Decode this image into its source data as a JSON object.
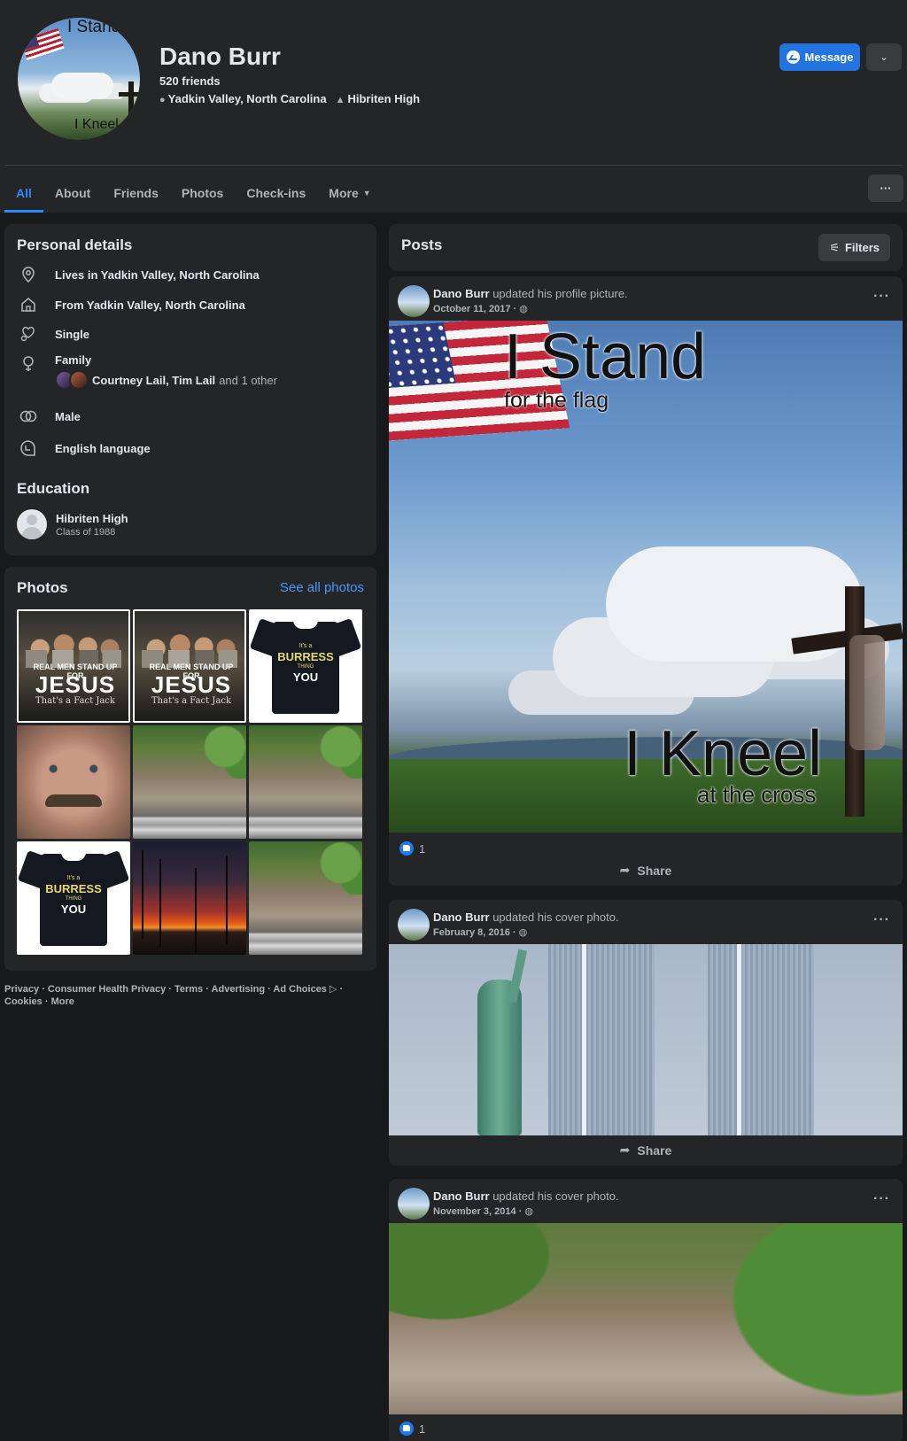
{
  "profile": {
    "name": "Dano Burr",
    "friends": "520 friends",
    "location": "Yadkin Valley, North Carolina",
    "school": "Hibriten High",
    "avatar_text_top": "I Stand",
    "avatar_text_bottom": "I Kneel",
    "message_label": "Message"
  },
  "tabs": [
    "All",
    "About",
    "Friends",
    "Photos",
    "Check-ins",
    "More"
  ],
  "personal_details": {
    "title": "Personal details",
    "lives": "Lives in Yadkin Valley, North Carolina",
    "from": "From Yadkin Valley, North Carolina",
    "relationship": "Single",
    "family_label": "Family",
    "family_names": "Courtney Lail, Tim Lail",
    "family_more": "and 1 other",
    "gender": "Male",
    "language": "English language"
  },
  "education": {
    "title": "Education",
    "school": "Hibriten High",
    "class": "Class of 1988"
  },
  "photos": {
    "title": "Photos",
    "see_all": "See all photos",
    "jesus_line1": "REAL MEN STAND UP FOR",
    "jesus_line2": "JESUS",
    "jesus_line3": "That's a Fact Jack",
    "shirt_line1": "It's a",
    "shirt_line2": "BURRESS",
    "shirt_line3": "THING",
    "shirt_line4": "YOU"
  },
  "footer": "Privacy · Consumer Health Privacy · Terms · Advertising · Ad Choices ▷ · Cookies · More",
  "posts_section": {
    "title": "Posts",
    "filters": "Filters"
  },
  "posts": [
    {
      "author": "Dano Burr",
      "action": "updated his profile picture.",
      "date": "October 11, 2017 ·",
      "likes": "1",
      "share": "Share",
      "img_t1": "I Stand",
      "img_t2": "for the flag",
      "img_t3": "I Kneel",
      "img_t4": "at the cross"
    },
    {
      "author": "Dano Burr",
      "action": "updated his cover photo.",
      "date": "February 8, 2016 ·",
      "share": "Share"
    },
    {
      "author": "Dano Burr",
      "action": "updated his cover photo.",
      "date": "November 3, 2014 ·",
      "likes": "1"
    }
  ]
}
